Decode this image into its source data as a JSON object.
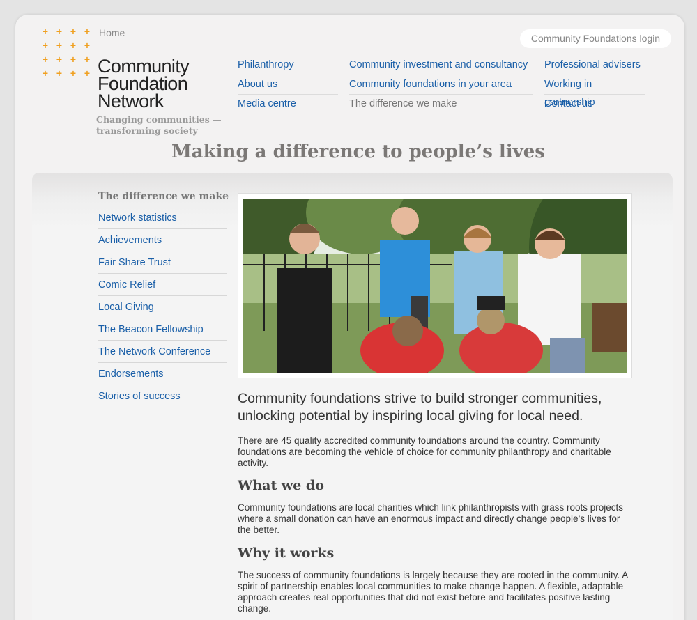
{
  "header": {
    "home": "Home",
    "logo_line1": "Community",
    "logo_line2": "Foundation",
    "logo_line3": "Network",
    "tagline_line1": "Changing communities —",
    "tagline_line2": "transforming society",
    "login": "Community Foundations login"
  },
  "nav": {
    "col1": [
      "Philanthropy",
      "About us",
      "Media centre"
    ],
    "col2": [
      "Community investment and consultancy",
      "Community foundations in your area",
      "The difference we make"
    ],
    "col3": [
      "Professional advisers",
      "Working in partnership",
      "Contact us"
    ]
  },
  "page_heading": "Making a difference to people’s lives",
  "sidebar": {
    "heading": "The difference we make",
    "items": [
      "Network statistics",
      "Achievements",
      "Fair Share Trust",
      "Comic Relief",
      "Local Giving",
      "The Beacon Fellowship",
      "The Network Conference",
      "Endorsements",
      "Stories of success"
    ]
  },
  "main": {
    "lead": "Community foundations strive to build stronger communities, unlocking potential by inspiring local giving for local need.",
    "intro": "There are 45 quality accredited community foundations around the country. Community foundations are becoming the vehicle of choice for community philanthropy and charitable activity.",
    "h_what": "What we do",
    "what": "Community foundations are local charities which link philanthropists with grass roots projects where a small donation can have an enormous impact and directly change people’s lives for the better.",
    "h_why": "Why it works",
    "why": "The success of community foundations is largely because they are rooted in the community. A spirit of partnership enables local communities to make change happen. A flexible, adaptable approach creates real opportunities that did not exist before and facilitates positive lasting change."
  },
  "colors": {
    "link": "#1a5fa8",
    "dots": "#f0a020",
    "heading": "#7b7876"
  }
}
